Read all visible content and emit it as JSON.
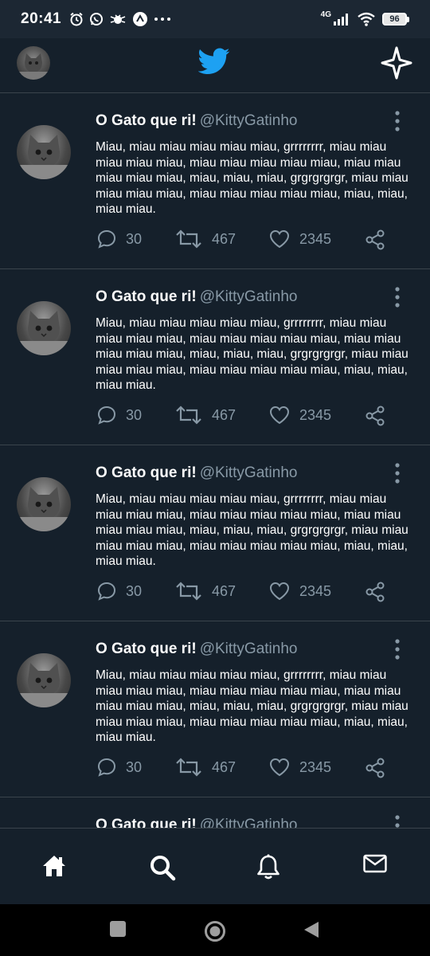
{
  "status_bar": {
    "time": "20:41",
    "network": "4G",
    "battery": "96"
  },
  "top_bar": {
    "logo_icon": "twitter-bird-icon",
    "right_icon": "sparkle-icon"
  },
  "tweets": [
    {
      "name": "O Gato que ri!",
      "handle": "@KittyGatinho",
      "text": "Miau, miau miau miau miau miau, grrrrrrrr, miau miau miau miau miau, miau miau miau miau miau, miau miau miau miau miau, miau, miau, miau, grgrgrgrgr, miau miau miau miau miau, miau miau miau miau miau, miau, miau, miau miau.",
      "replies": "30",
      "retweets": "467",
      "likes": "2345"
    },
    {
      "name": "O Gato que ri!",
      "handle": "@KittyGatinho",
      "text": "Miau, miau miau miau miau miau, grrrrrrrr, miau miau miau miau miau, miau miau miau miau miau, miau miau miau miau miau, miau, miau, miau, grgrgrgrgr, miau miau miau miau miau, miau miau miau miau miau, miau, miau, miau miau.",
      "replies": "30",
      "retweets": "467",
      "likes": "2345"
    },
    {
      "name": "O Gato que ri!",
      "handle": "@KittyGatinho",
      "text": "Miau, miau miau miau miau miau, grrrrrrrr, miau miau miau miau miau, miau miau miau miau miau, miau miau miau miau miau, miau, miau, miau, grgrgrgrgr, miau miau miau miau miau, miau miau miau miau miau, miau, miau, miau miau.",
      "replies": "30",
      "retweets": "467",
      "likes": "2345"
    },
    {
      "name": "O Gato que ri!",
      "handle": "@KittyGatinho",
      "text": "Miau, miau miau miau miau miau, grrrrrrrr, miau miau miau miau miau, miau miau miau miau miau, miau miau miau miau miau, miau, miau, miau, grgrgrgrgr, miau miau miau miau miau, miau miau miau miau miau, miau, miau, miau miau.",
      "replies": "30",
      "retweets": "467",
      "likes": "2345"
    },
    {
      "name": "O Gato que ri!",
      "handle": "@KittyGatinho",
      "text": "",
      "replies": "",
      "retweets": "",
      "likes": ""
    }
  ],
  "bottom_nav": [
    "home-icon",
    "search-icon",
    "bell-icon",
    "mail-icon"
  ],
  "colors": {
    "background": "#15202b",
    "accent": "#1da1f2",
    "muted": "#8899a6",
    "divider": "#3a444c"
  }
}
